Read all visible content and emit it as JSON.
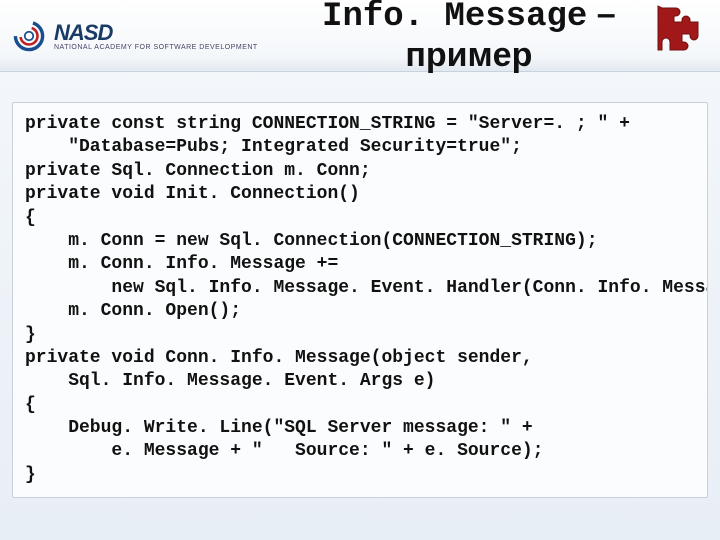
{
  "logo": {
    "name": "NASD",
    "subtitle": "NATIONAL ACADEMY FOR\nSOFTWARE DEVELOPMENT"
  },
  "title": {
    "code": "Info. Message",
    "dash": " – ",
    "ru": "пример"
  },
  "code": "private const string CONNECTION_STRING = \"Server=. ; \" +\n    \"Database=Pubs; Integrated Security=true\";\nprivate Sql. Connection m. Conn;\nprivate void Init. Connection()\n{\n    m. Conn = new Sql. Connection(CONNECTION_STRING);\n    m. Conn. Info. Message +=\n        new Sql. Info. Message. Event. Handler(Conn. Info. Message);\n    m. Conn. Open();\n}\nprivate void Conn. Info. Message(object sender,\n    Sql. Info. Message. Event. Args e)\n{\n    Debug. Write. Line(\"SQL Server message: \" +\n        e. Message + \"   Source: \" + e. Source);\n}"
}
